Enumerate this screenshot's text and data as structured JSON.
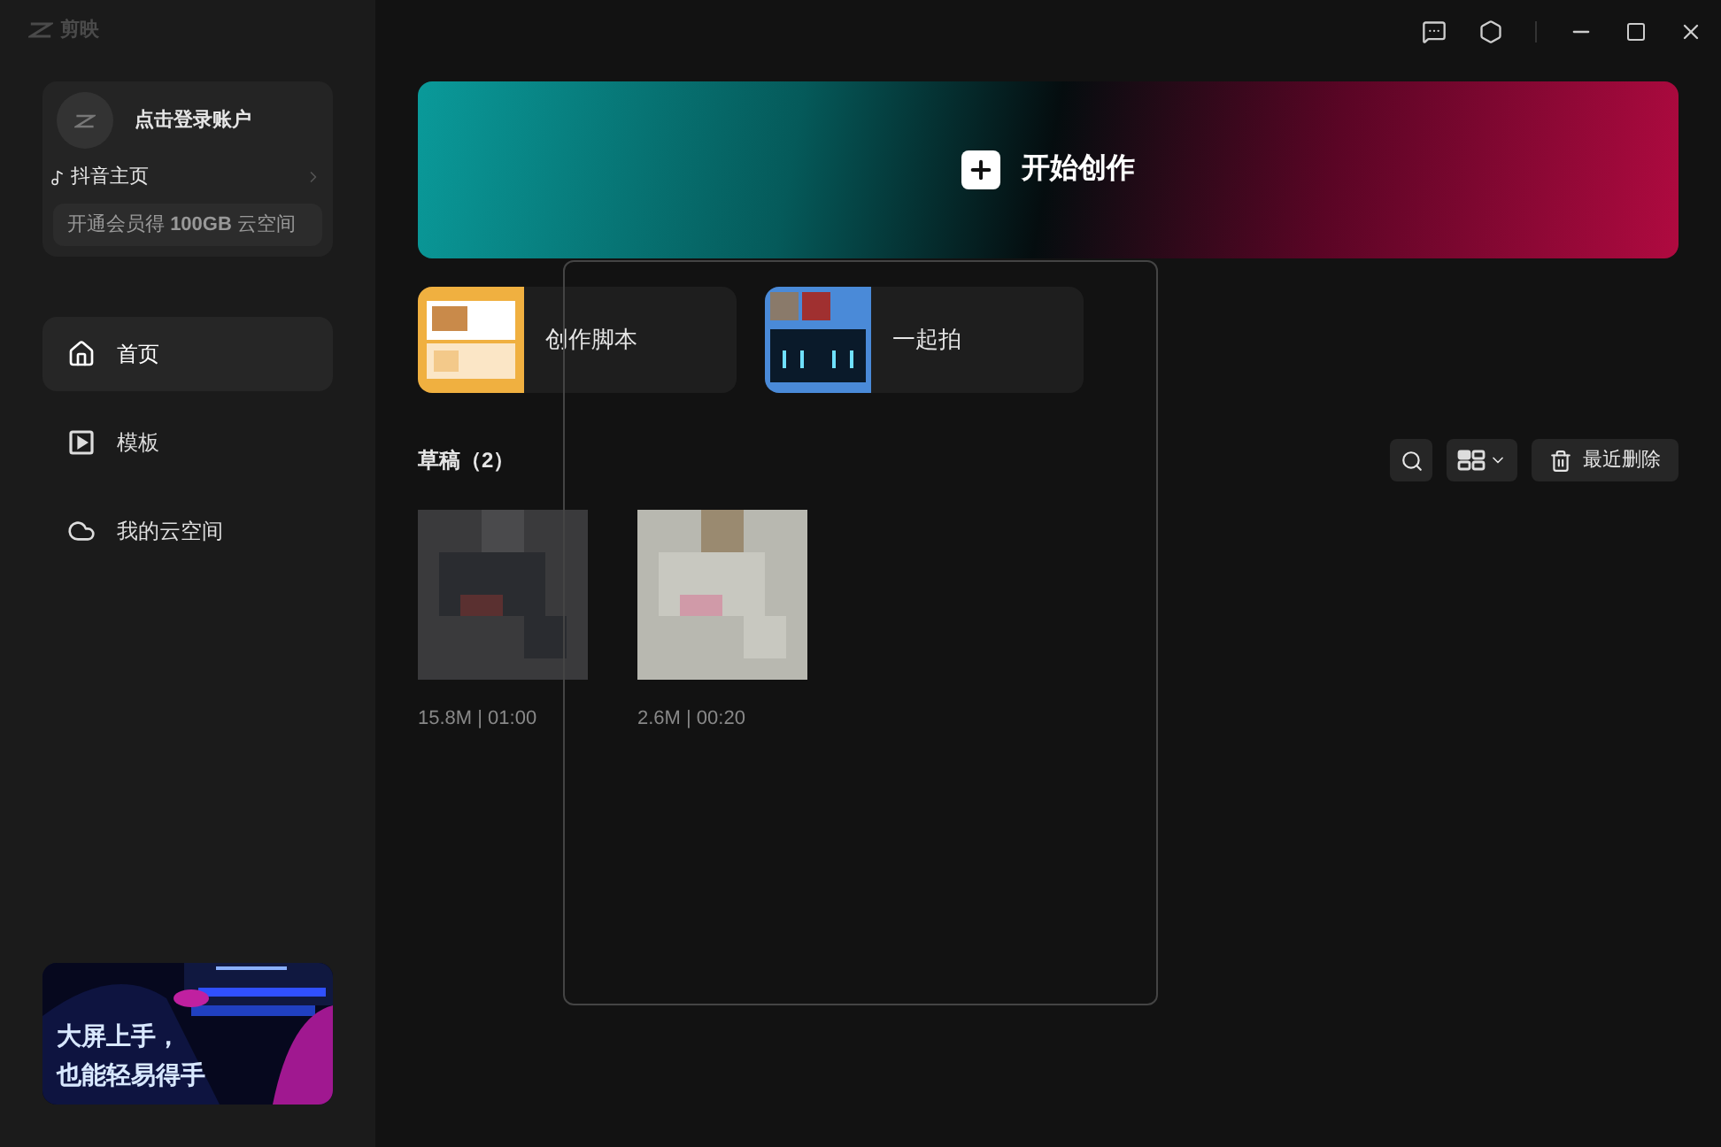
{
  "app": {
    "title": "剪映"
  },
  "account": {
    "login": "点击登录账户",
    "douyin": "抖音主页",
    "promo": "开通会员得 **100GB** 云空间"
  },
  "nav": [
    {
      "kind": "home",
      "label": "首页",
      "selected": true
    },
    {
      "kind": "template",
      "label": "模板",
      "selected": false
    },
    {
      "kind": "cloud",
      "label": "我的云空间",
      "selected": false
    }
  ],
  "banner": {
    "line1": "大屏上手，",
    "line2": "也能轻易得手"
  },
  "create": {
    "label": "开始创作"
  },
  "shortcuts": [
    {
      "kind": "script",
      "label": "创作脚本"
    },
    {
      "kind": "together",
      "label": "一起拍"
    }
  ],
  "drafts": {
    "title": "草稿（2）",
    "trash": "最近删除",
    "items": [
      {
        "meta": "15.8M | 01:00"
      },
      {
        "meta": "2.6M | 00:20"
      }
    ]
  }
}
